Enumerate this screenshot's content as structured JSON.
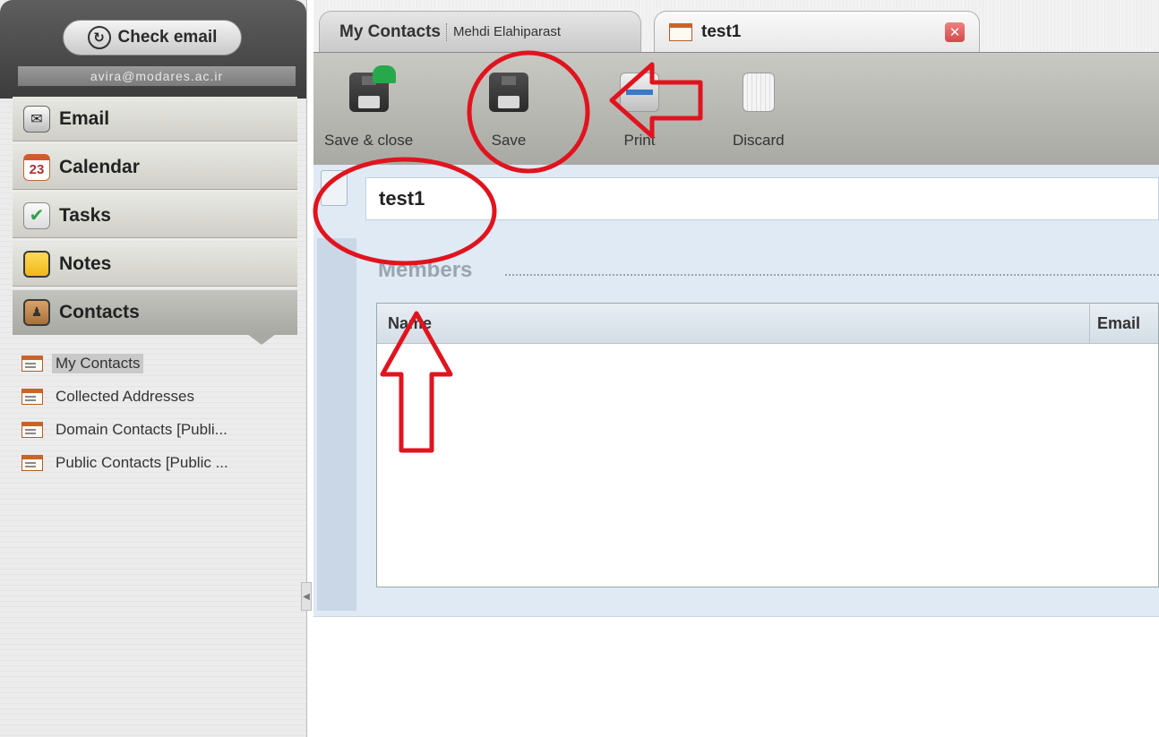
{
  "sidebar": {
    "check_email_label": "Check email",
    "account": "avira@modares.ac.ir",
    "nav": [
      {
        "label": "Email",
        "icon": "envelope-icon"
      },
      {
        "label": "Calendar",
        "icon": "calendar-icon",
        "icon_text": "23"
      },
      {
        "label": "Tasks",
        "icon": "checkmark-icon"
      },
      {
        "label": "Notes",
        "icon": "note-icon"
      },
      {
        "label": "Contacts",
        "icon": "contacts-book-icon"
      }
    ],
    "folders": [
      {
        "label": "My Contacts",
        "selected": true
      },
      {
        "label": "Collected Addresses"
      },
      {
        "label": "Domain Contacts [Publi..."
      },
      {
        "label": "Public Contacts [Public ..."
      }
    ]
  },
  "tabs": {
    "contacts_tab": {
      "title": "My Contacts",
      "owner": "Mehdi Elahiparast"
    },
    "group_tab": {
      "title": "test1",
      "close_icon": "close-icon"
    }
  },
  "toolbar": {
    "save_close_label": "Save & close",
    "save_label": "Save",
    "print_label": "Print",
    "discard_label": "Discard"
  },
  "form": {
    "group_name_value": "test1",
    "members_title": "Members",
    "columns": {
      "name": "Name",
      "email": "Email"
    }
  },
  "colors": {
    "annotation_red": "#e0141e",
    "form_background": "#dfeaf4",
    "toolbar_background": "#b9b9b4"
  }
}
